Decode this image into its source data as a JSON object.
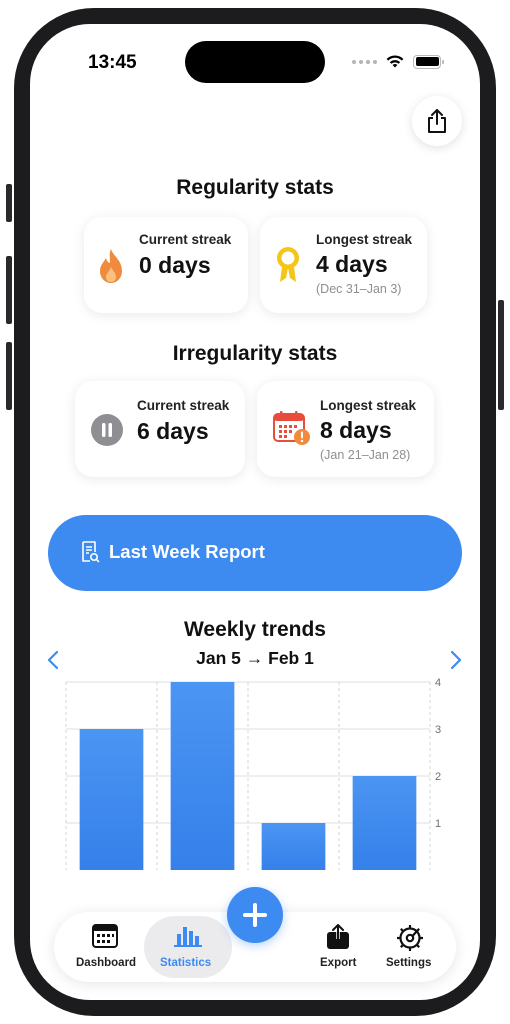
{
  "status_bar": {
    "time": "13:45"
  },
  "regularity": {
    "title": "Regularity stats",
    "current": {
      "label": "Current streak",
      "value": "0 days"
    },
    "longest": {
      "label": "Longest streak",
      "value": "4 days",
      "range": "(Dec 31–Jan 3)"
    }
  },
  "irregularity": {
    "title": "Irregularity stats",
    "current": {
      "label": "Current streak",
      "value": "6 days"
    },
    "longest": {
      "label": "Longest streak",
      "value": "8 days",
      "range": "(Jan 21–Jan 28)"
    }
  },
  "report_button": {
    "label": "Last Week Report"
  },
  "weekly_trends": {
    "title": "Weekly trends",
    "range": "Jan 5 → Feb 1"
  },
  "chart_data": {
    "type": "bar",
    "categories": [
      "",
      "",
      "",
      ""
    ],
    "values": [
      3,
      4,
      1,
      2
    ],
    "ylim": [
      0,
      4
    ],
    "yticks": [
      "1",
      "2",
      "3",
      "4"
    ],
    "grid": true,
    "color": "#3d8af0"
  },
  "tabbar": {
    "dashboard": "Dashboard",
    "statistics": "Statistics",
    "export": "Export",
    "settings": "Settings"
  },
  "colors": {
    "accent": "#3d8af0",
    "flame": "#f08a3c",
    "medal": "#f5c518",
    "pause": "#8e8e93",
    "calendar": "#e74c3c"
  }
}
